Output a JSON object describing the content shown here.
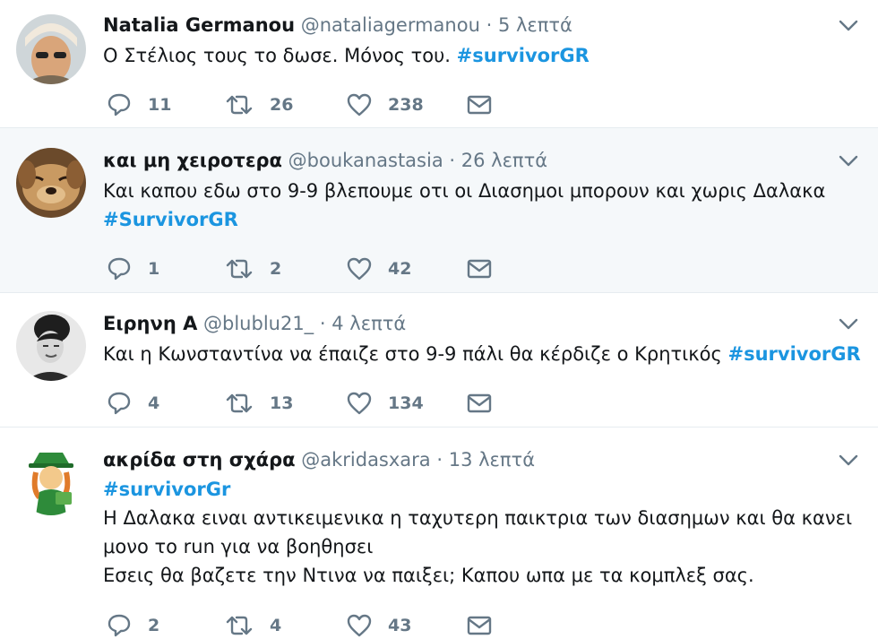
{
  "tweets": [
    {
      "name": "Natalia Germanou",
      "handle": "@nataliagermanou",
      "sep": "·",
      "time": "5 λεπτά",
      "lines": [
        {
          "pre": "Ο Στέλιος τους το δωσε. Μόνος του. ",
          "tag": "#survivorGR",
          "post": ""
        }
      ],
      "reply_count": "11",
      "retweet_count": "26",
      "like_count": "238",
      "avatar_colors": [
        "#d9a57a",
        "#f1e9dc"
      ]
    },
    {
      "name": "και μη χειροτερα",
      "handle": "@boukanastasia",
      "sep": "·",
      "time": "26 λεπτά",
      "lines": [
        {
          "pre": "Και καπου εδω στο 9-9 βλεπουμε οτι οι Διασημοι μπορουν και χωρις Δαλακα",
          "tag": "",
          "post": ""
        },
        {
          "pre": "",
          "tag": "#SurvivorGR",
          "post": ""
        }
      ],
      "reply_count": "1",
      "retweet_count": "2",
      "like_count": "42",
      "avatar_colors": [
        "#8b5e34",
        "#c99a62"
      ]
    },
    {
      "name": "Ειρηνη Α",
      "handle": "@blublu21_",
      "sep": "·",
      "time": "4 λεπτά",
      "lines": [
        {
          "pre": "Και η Κωνσταντίνα να έπαιζε στο 9-9 πάλι θα κέρδιζε ο Κρητικός ",
          "tag": "#survivorGR",
          "post": ""
        }
      ],
      "reply_count": "4",
      "retweet_count": "13",
      "like_count": "134",
      "avatar_colors": [
        "#2b2b2b",
        "#e8e8e8"
      ]
    },
    {
      "name": "ακρίδα στη σχάρα",
      "handle": "@akridasxara",
      "sep": "·",
      "time": "13 λεπτά",
      "lines": [
        {
          "pre": "",
          "tag": "#survivorGr",
          "post": ""
        },
        {
          "pre": "Η Δαλακα ειναι αντικειμενικα η ταχυτερη παικτρια των διασημων και θα κανει",
          "tag": "",
          "post": ""
        },
        {
          "pre": "μονο το run για να βοηθησει",
          "tag": "",
          "post": ""
        },
        {
          "pre": "Εσεις θα βαζετε την Ντινα να παιξει; Καπου ωπα με τα κομπλεξ σας.",
          "tag": "",
          "post": ""
        }
      ],
      "reply_count": "2",
      "retweet_count": "4",
      "like_count": "43",
      "avatar_colors": [
        "#2e8b3a",
        "#f3c98b"
      ]
    }
  ],
  "colors": {
    "text": "#14171a",
    "muted": "#657786",
    "hashtag": "#1b95e0",
    "highlight_bg": "#f5f8fa",
    "divider": "#e6ecf0"
  },
  "icons": {
    "reply": "reply-icon",
    "retweet": "retweet-icon",
    "like": "heart-icon",
    "dm": "envelope-icon",
    "menu": "chevron-down-icon"
  }
}
